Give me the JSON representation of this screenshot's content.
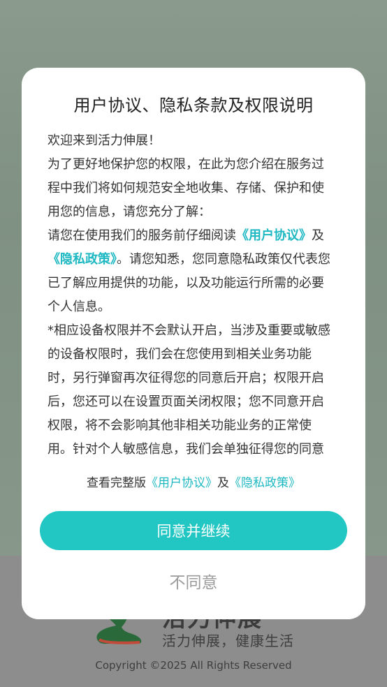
{
  "app": {
    "name": "活力伸展",
    "slogan": "活力伸展，健康生活",
    "copyright": "Copyright ©2025 All Rights Reserved"
  },
  "dialog": {
    "title": "用户协议、隐私条款及权限说明",
    "para1": "欢迎来到活力伸展！",
    "para2": "为了更好地保护您的权限，在此为您介绍在服务过程中我们将如何规范安全地收集、存储、保护和使用您的信息，请您充分了解：",
    "para3_prefix": "请您在使用我们的服务前仔细阅读",
    "para3_link1": "《用户协议》",
    "para3_mid": "及",
    "para3_link2": "《隐私政策》",
    "para3_suffix": "。请您知悉，您同意隐私政策仅代表您已了解应用提供的功能，以及功能运行所需的必要个人信息。",
    "para4": "*相应设备权限并不会默认开启，当涉及重要或敏感的设备权限时，我们会在您使用到相关业务功能时，另行弹窗再次征得您的同意后开启；权限开启后，您还可以在设置页面关闭权限；您不同意开启权限，将不会影响其他非相关功能业务的正常使用。针对个人敏感信息，我们会单独征得您的同意",
    "view_prefix": "查看完整版",
    "view_link1": "《用户协议》",
    "view_mid": "及",
    "view_link2": "《隐私政策》",
    "agree_label": "同意并继续",
    "disagree_label": "不同意"
  },
  "colors": {
    "accent": "#22c7c3",
    "link": "#1eb8c2"
  }
}
